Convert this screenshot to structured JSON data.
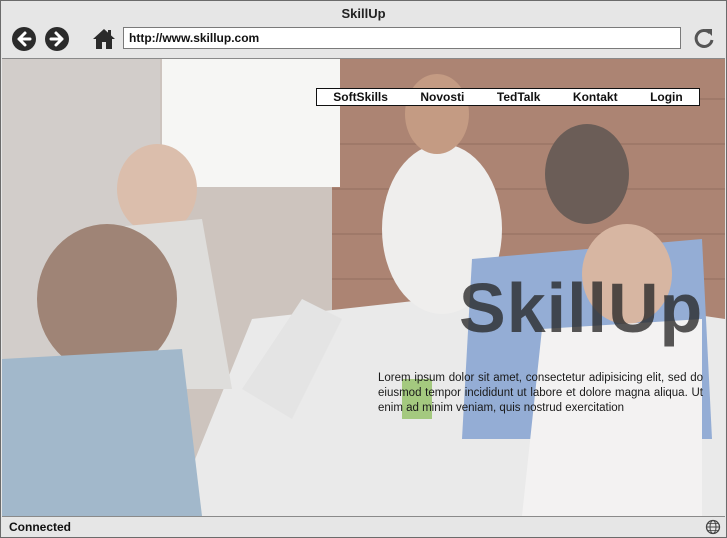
{
  "window": {
    "title": "SkillUp"
  },
  "toolbar": {
    "back_icon": "arrow-left-circle-icon",
    "forward_icon": "arrow-right-circle-icon",
    "home_icon": "home-icon",
    "url": "http://www.skillup.com",
    "reload_icon": "reload-icon"
  },
  "nav": {
    "items": [
      {
        "label": "SoftSkills"
      },
      {
        "label": "Novosti"
      },
      {
        "label": "TedTalk"
      },
      {
        "label": "Kontakt"
      },
      {
        "label": "Login"
      }
    ]
  },
  "hero": {
    "title": "SkillUp",
    "body": "Lorem ipsum dolor sit amet, consectetur adipisicing elit, sed do eiusmod tempor incididunt ut labore et dolore magna aliqua. Ut enim ad minim veniam, quis nostrud exercitation"
  },
  "status": {
    "text": "Connected",
    "icon": "globe-icon"
  }
}
